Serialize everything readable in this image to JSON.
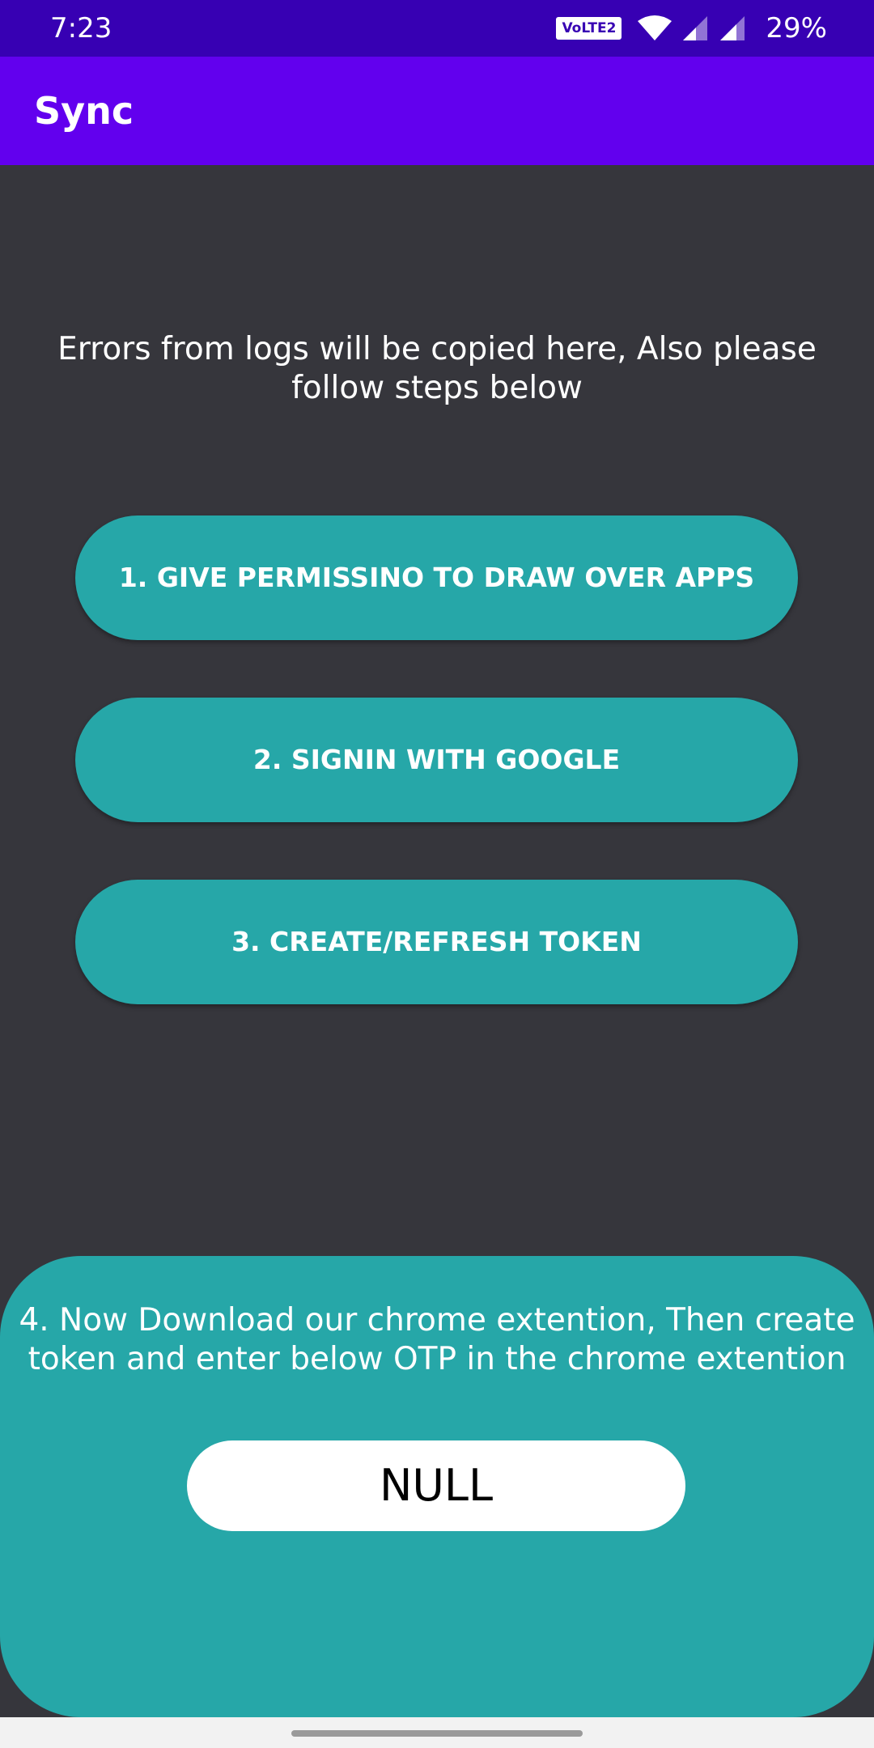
{
  "status_bar": {
    "time": "7:23",
    "volte": "VoLTE2",
    "battery": "29%",
    "icons": [
      "wifi-icon",
      "signal-icon",
      "signal-icon"
    ]
  },
  "app_bar": {
    "title": "Sync"
  },
  "info_text": "Errors from logs will be copied here, Also please follow steps below",
  "steps": [
    "1. GIVE PERMISSINO TO DRAW OVER APPS",
    "2. SIGNIN WITH GOOGLE",
    "3. CREATE/REFRESH TOKEN"
  ],
  "card": {
    "text": "4. Now Download our chrome extention, Then create token and enter below OTP in the chrome extention",
    "otp_value": "NULL"
  },
  "colors": {
    "status_bar": "#3700b3",
    "app_bar": "#6200ee",
    "background": "#36363c",
    "accent": "#26a7a8"
  }
}
